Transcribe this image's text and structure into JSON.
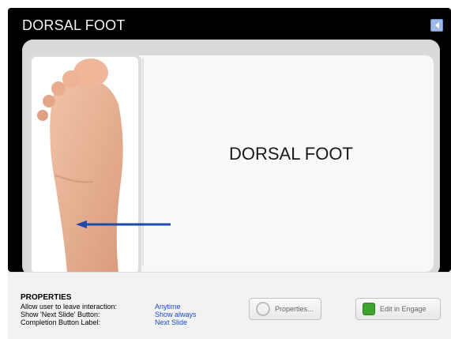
{
  "window": {
    "title": "DORSAL FOOT"
  },
  "slide": {
    "heading": "DORSAL FOOT"
  },
  "properties": {
    "title": "PROPERTIES",
    "rows": [
      {
        "label": "Allow user to leave interaction:",
        "value": "Anytime"
      },
      {
        "label": "Show 'Next Slide' Button:",
        "value": "Show always"
      },
      {
        "label": "Completion Button Label:",
        "value": "Next Slide"
      }
    ],
    "buttons": {
      "properties_label": "Properties...",
      "engage_label": "Edit in Engage"
    }
  },
  "colors": {
    "value_link": "#1a4ec2",
    "arrow": "#1f4aa8"
  },
  "icons": [
    "back-icon",
    "gear-icon",
    "engage-icon",
    "arrow-icon"
  ]
}
